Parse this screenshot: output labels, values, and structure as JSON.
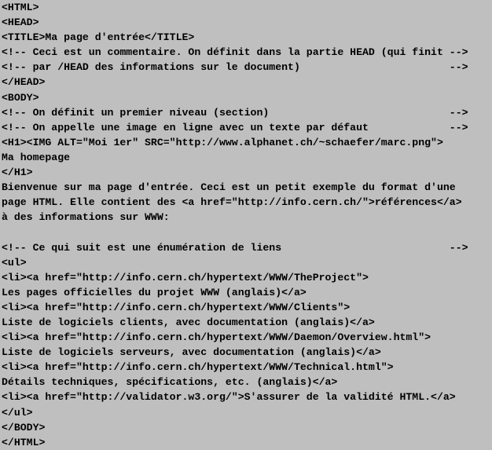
{
  "lines": [
    "<HTML>",
    "<HEAD>",
    "<TITLE>Ma page d'entrée</TITLE>",
    "<!-- Ceci est un commentaire. On définit dans la partie HEAD (qui finit -->",
    "<!-- par /HEAD des informations sur le document)                        -->",
    "</HEAD>",
    "<BODY>",
    "<!-- On définit un premier niveau (section)                             -->",
    "<!-- On appelle une image en ligne avec un texte par défaut             -->",
    "<H1><IMG ALT=\"Moi 1er\" SRC=\"http://www.alphanet.ch/~schaefer/marc.png\">",
    "Ma homepage",
    "</H1>",
    "Bienvenue sur ma page d'entrée. Ceci est un petit exemple du format d'une",
    "page HTML. Elle contient des <a href=\"http://info.cern.ch/\">références</a>",
    "à des informations sur WWW:",
    "",
    "<!-- Ce qui suit est une énumération de liens                           -->",
    "<ul>",
    "<li><a href=\"http://info.cern.ch/hypertext/WWW/TheProject\">",
    "Les pages officielles du projet WWW (anglais)</a>",
    "<li><a href=\"http://info.cern.ch/hypertext/WWW/Clients\">",
    "Liste de logiciels clients, avec documentation (anglais)</a>",
    "<li><a href=\"http://info.cern.ch/hypertext/WWW/Daemon/Overview.html\">",
    "Liste de logiciels serveurs, avec documentation (anglais)</a>",
    "<li><a href=\"http://info.cern.ch/hypertext/WWW/Technical.html\">",
    "Détails techniques, spécifications, etc. (anglais)</a>",
    "<li><a href=\"http://validator.w3.org/\">S'assurer de la validité HTML.</a>",
    "</ul>",
    "</BODY>",
    "</HTML>"
  ]
}
